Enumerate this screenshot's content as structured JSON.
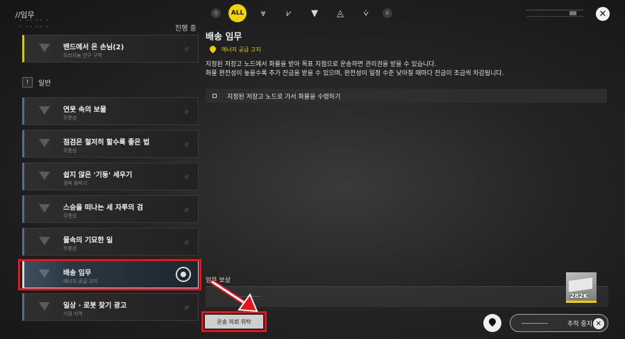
{
  "header": {
    "breadcrumb": "//임무",
    "filters": [
      {
        "icon": "search-icon",
        "glyph": "Q",
        "small": true
      },
      {
        "icon": "all-filter-icon",
        "glyph": "ALL",
        "active": true
      },
      {
        "icon": "main-quest-filter-icon",
        "glyph": "⩔"
      },
      {
        "icon": "side-quest-filter-icon",
        "glyph": "⩗"
      },
      {
        "icon": "commission-filter-icon",
        "glyph": "▼"
      },
      {
        "icon": "daily-filter-icon",
        "glyph": "◬"
      },
      {
        "icon": "event-filter-icon",
        "glyph": "⩒"
      },
      {
        "icon": "e-filter-icon",
        "glyph": "E",
        "small": true
      }
    ]
  },
  "list": {
    "progress_tab": "진행 중",
    "pinned": {
      "title": "밴드에서 온 손님(2)",
      "subtitle": "오리지늄 연구 구역"
    },
    "section_label": "일반",
    "section_badge": "!",
    "quests": [
      {
        "title": "연못 속의 보물",
        "subtitle": "무릉성"
      },
      {
        "title": "점검은 철저히 할수록 좋은 법",
        "subtitle": "무릉성"
      },
      {
        "title": "쉽지 않은 '기둥' 세우기",
        "subtitle": "경옥 광파기"
      },
      {
        "title": "스승을 떠나는 세 자루의 검",
        "subtitle": "무릉성"
      },
      {
        "title": "물속의 기묘한 일",
        "subtitle": "무릉성"
      },
      {
        "title": "배송 임무",
        "subtitle": "에너지 공급 고지",
        "selected": true
      },
      {
        "title": "일상 · 로봇 찾기 광고",
        "subtitle": "거점 지역"
      }
    ]
  },
  "detail": {
    "title": "배송 임무",
    "location": "에너지 공급 고지",
    "description_line1": "지정된 저장고 노드에서 화물을 받아 목표 지점으로 운송하면 관리권을 받을 수 있습니다.",
    "description_line2": "화물 완전성이 높을수록 추가 잔금을 받을 수 있으며, 완전성이 일정 수준 낮아질 때마다 잔금이 조금씩 차감됩니다.",
    "objective": "지정된 저장고 노드로 가서 화물을 수령하기",
    "reward_label": "임무 보상",
    "reward_amount": "282K",
    "request_button": "운송 의뢰 위탁",
    "track_stop_button": "추적 중지"
  },
  "colors": {
    "accent_yellow": "#f4d400",
    "annotation_red": "#e8141a"
  }
}
